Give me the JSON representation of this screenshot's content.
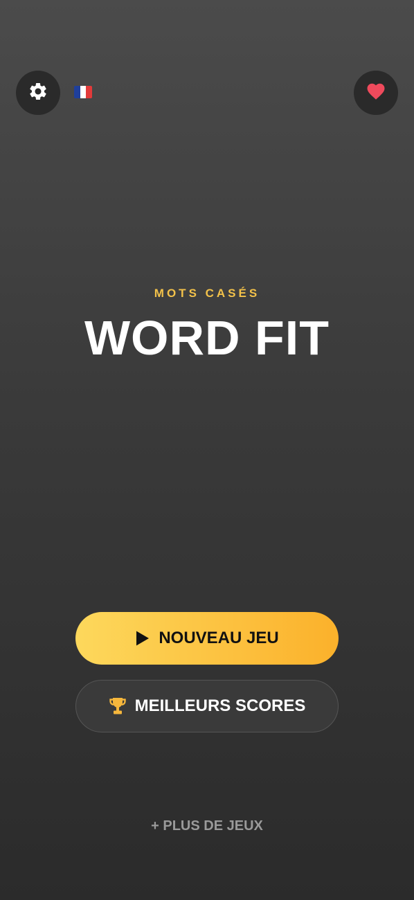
{
  "header": {
    "settings_icon": "gear-icon",
    "language_flag": "flag-fr-icon",
    "favorite_icon": "heart-icon"
  },
  "hero": {
    "subtitle": "MOTS CASÉS",
    "title": "WORD FIT"
  },
  "actions": {
    "new_game": {
      "label": "NOUVEAU JEU",
      "icon": "play-icon"
    },
    "high_scores": {
      "label": "MEILLEURS SCORES",
      "icon": "trophy-icon"
    }
  },
  "footer": {
    "more_games": "+ PLUS DE JEUX"
  },
  "colors": {
    "accent": "#f3c24a",
    "button_gradient_start": "#fdd85c",
    "button_gradient_end": "#fbb12b",
    "heart": "#ef4a5c",
    "flag_blue": "#1f3f9b",
    "flag_white": "#ffffff",
    "flag_red": "#e23a3a"
  }
}
